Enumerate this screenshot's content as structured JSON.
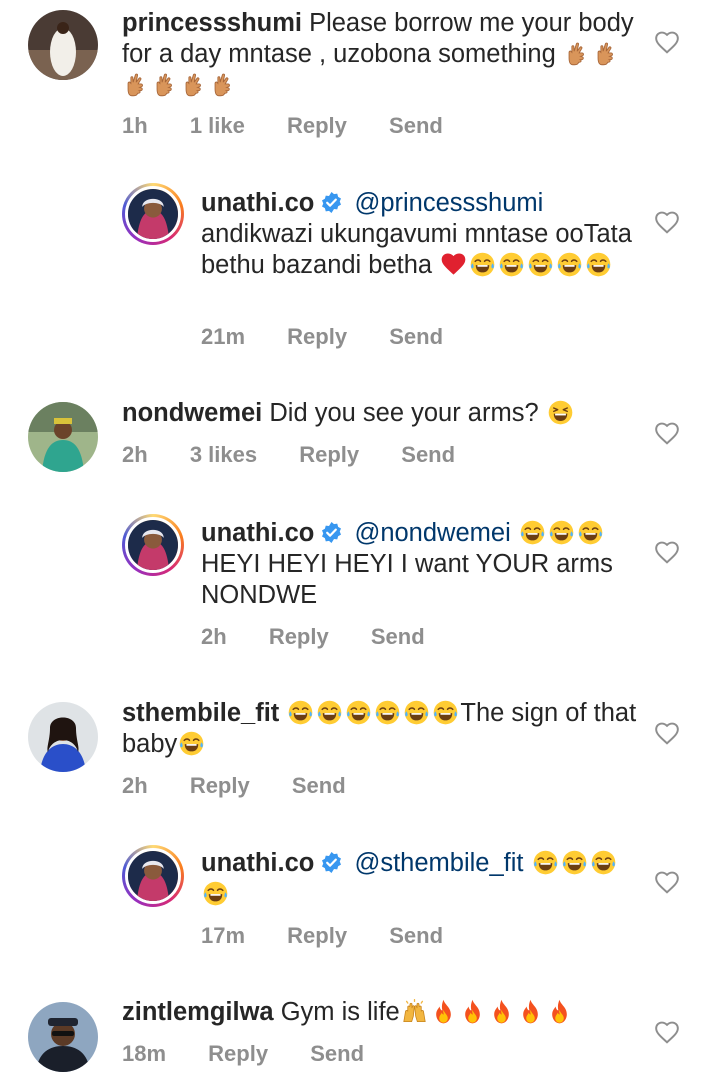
{
  "comments": [
    {
      "type": "top",
      "username": "princessshumi",
      "text": "Please borrow me your body for a day mntase , uzobona something",
      "emoji": [
        "fingers-crossed",
        "fingers-crossed",
        "fingers-crossed",
        "fingers-crossed",
        "fingers-crossed",
        "fingers-crossed"
      ],
      "time": "1h",
      "likes": "1 like",
      "reply_label": "Reply",
      "send_label": "Send"
    },
    {
      "type": "reply",
      "username": "unathi.co",
      "verified": true,
      "mention": "@princessshumi",
      "text": "andikwazi ukungavumi mntase ooTata bethu bazandi betha",
      "emoji": [
        "red-heart",
        "tears-of-joy",
        "tears-of-joy",
        "tears-of-joy",
        "tears-of-joy",
        "tears-of-joy"
      ],
      "time": "21m",
      "reply_label": "Reply",
      "send_label": "Send"
    },
    {
      "type": "top",
      "username": "nondwemei",
      "text": "Did you see your arms?",
      "emoji": [
        "grinning-squint"
      ],
      "time": "2h",
      "likes": "3 likes",
      "reply_label": "Reply",
      "send_label": "Send"
    },
    {
      "type": "reply",
      "username": "unathi.co",
      "verified": true,
      "mention": "@nondwemei",
      "emoji": [
        "tears-of-joy",
        "tears-of-joy",
        "tears-of-joy"
      ],
      "text": "HEYI HEYI HEYI I want YOUR arms NONDWE",
      "time": "2h",
      "reply_label": "Reply",
      "send_label": "Send"
    },
    {
      "type": "top",
      "username": "sthembile_fit",
      "emoji": [
        "tears-of-joy",
        "tears-of-joy",
        "tears-of-joy",
        "tears-of-joy",
        "tears-of-joy",
        "tears-of-joy"
      ],
      "text": "The sign of that baby",
      "emoji_after": [
        "tears-of-joy"
      ],
      "time": "2h",
      "reply_label": "Reply",
      "send_label": "Send"
    },
    {
      "type": "reply",
      "username": "unathi.co",
      "verified": true,
      "mention": "@sthembile_fit",
      "emoji": [
        "tears-of-joy",
        "tears-of-joy",
        "tears-of-joy",
        "tears-of-joy"
      ],
      "time": "17m",
      "reply_label": "Reply",
      "send_label": "Send"
    },
    {
      "type": "top",
      "username": "zintlemgilwa",
      "text": "Gym is life",
      "emoji": [
        "raising-hands",
        "fire",
        "fire",
        "fire",
        "fire",
        "fire"
      ],
      "time": "18m",
      "reply_label": "Reply",
      "send_label": "Send"
    }
  ],
  "colors": {
    "text": "#262626",
    "meta": "#8e8e8e",
    "mention": "#00376b",
    "verified": "#3897f0",
    "heart_outline": "#8e8e8e"
  },
  "icons": {
    "like": "heart-outline-icon",
    "verified": "verified-badge-icon"
  }
}
